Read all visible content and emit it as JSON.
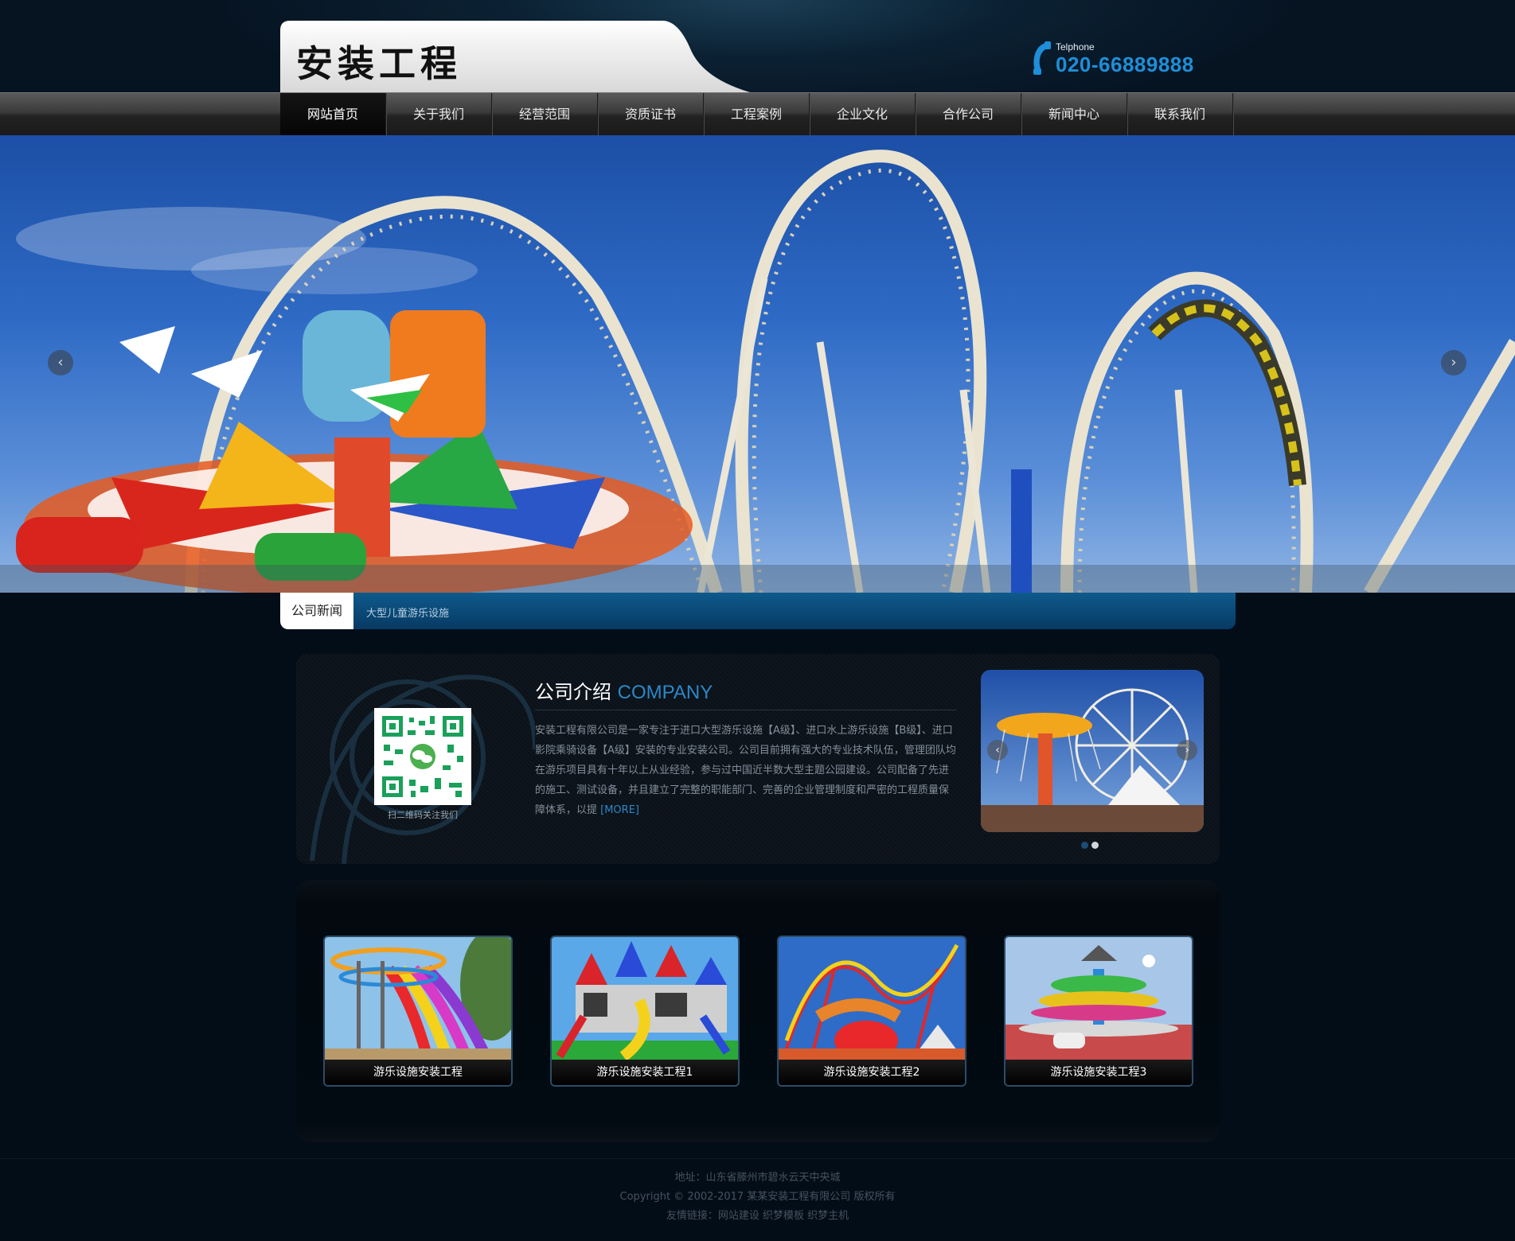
{
  "header": {
    "logo_text": "安装工程",
    "phone_label": "Telphone",
    "phone_number": "020-66889888"
  },
  "nav": {
    "items": [
      {
        "label": "网站首页",
        "active": true
      },
      {
        "label": "关于我们"
      },
      {
        "label": "经营范围"
      },
      {
        "label": "资质证书"
      },
      {
        "label": "工程案例"
      },
      {
        "label": "企业文化"
      },
      {
        "label": "合作公司"
      },
      {
        "label": "新闻中心"
      },
      {
        "label": "联系我们"
      }
    ]
  },
  "banner": {
    "prev_glyph": "‹",
    "next_glyph": "›"
  },
  "news": {
    "title": "公司新闻",
    "item": "大型儿童游乐设施"
  },
  "about": {
    "title_cn": "公司介绍",
    "title_en": "COMPANY",
    "qr_caption": "扫二维码关注我们",
    "body": "安装工程有限公司是一家专注于进口大型游乐设施【A级】、进口水上游乐设施【B级】、进口影院乘骑设备【A级】安装的专业安装公司。公司目前拥有强大的专业技术队伍，管理团队均在游乐项目具有十年以上从业经验，参与过中国近半数大型主题公园建设。公司配备了先进的施工、测试设备，并且建立了完整的职能部门、完善的企业管理制度和严密的工程质量保障体系，以提 ",
    "more": "[MORE]"
  },
  "products": [
    {
      "caption": "游乐设施安装工程"
    },
    {
      "caption": "游乐设施安装工程1"
    },
    {
      "caption": "游乐设施安装工程2"
    },
    {
      "caption": "游乐设施安装工程3"
    }
  ],
  "footer": {
    "address": "地址：山东省滕州市碧水云天中央城",
    "copyright": "Copyright © 2002-2017 某某安装工程有限公司 版权所有",
    "links": "友情链接：网站建设 织梦模板 织梦主机"
  },
  "colors": {
    "accent_blue": "#2b88c8",
    "page_bg": "#020d18"
  }
}
